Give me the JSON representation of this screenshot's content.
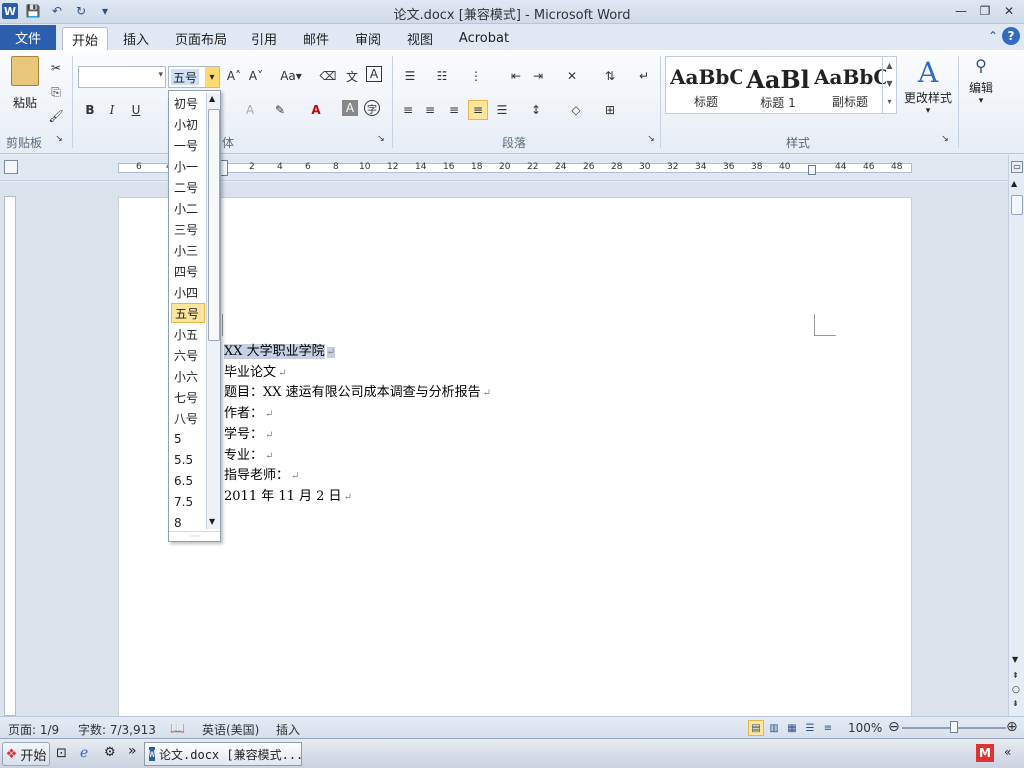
{
  "window": {
    "title": "论文.docx [兼容模式] - Microsoft Word",
    "app_badge": "W",
    "quick_access": [
      "save-icon",
      "undo-icon",
      "redo-icon",
      "customize-icon"
    ]
  },
  "tabs": {
    "file": "文件",
    "items": [
      "开始",
      "插入",
      "页面布局",
      "引用",
      "邮件",
      "审阅",
      "视图",
      "Acrobat"
    ],
    "active": "开始"
  },
  "ribbon": {
    "clipboard": {
      "paste": "粘贴",
      "label": "剪贴板"
    },
    "font": {
      "label_partial": "体",
      "size_value": "五号",
      "font_value": ""
    },
    "paragraph": {
      "label": "段落"
    },
    "styles": {
      "label": "样式",
      "items": [
        {
          "preview": "AaBbC",
          "label": "标题"
        },
        {
          "preview": "AaBl",
          "label": "标题 1"
        },
        {
          "preview": "AaBbC",
          "label": "副标题"
        }
      ],
      "change": "更改样式"
    },
    "editing": {
      "label": "编辑"
    }
  },
  "font_size_dropdown": {
    "items": [
      "初号",
      "小初",
      "一号",
      "小一",
      "二号",
      "小二",
      "三号",
      "小三",
      "四号",
      "小四",
      "五号",
      "小五",
      "六号",
      "小六",
      "七号",
      "八号",
      "5",
      "5.5",
      "6.5",
      "7.5",
      "8"
    ],
    "selected": "五号"
  },
  "ruler": {
    "left_ticks": [
      "6",
      "4"
    ],
    "ticks": [
      "2",
      "4",
      "6",
      "8",
      "10",
      "12",
      "14",
      "16",
      "18",
      "20",
      "22",
      "24",
      "26",
      "28",
      "30",
      "32",
      "34",
      "36",
      "38",
      "40",
      "44",
      "46",
      "48"
    ]
  },
  "document": {
    "lines": [
      "XX 大学职业学院",
      "毕业论文",
      "题目：XX 速运有限公司成本调查与分析报告",
      "作者：",
      "学号：",
      "专业：",
      "指导老师：",
      "2011 年 11 月 2 日"
    ],
    "paragraph_mark": "↵"
  },
  "status": {
    "page": "页面: 1/9",
    "words": "字数: 7/3,913",
    "language": "英语(美国)",
    "mode": "插入",
    "zoom": "100%"
  },
  "taskbar": {
    "start": "开始",
    "task": "论文.docx [兼容模式..."
  }
}
